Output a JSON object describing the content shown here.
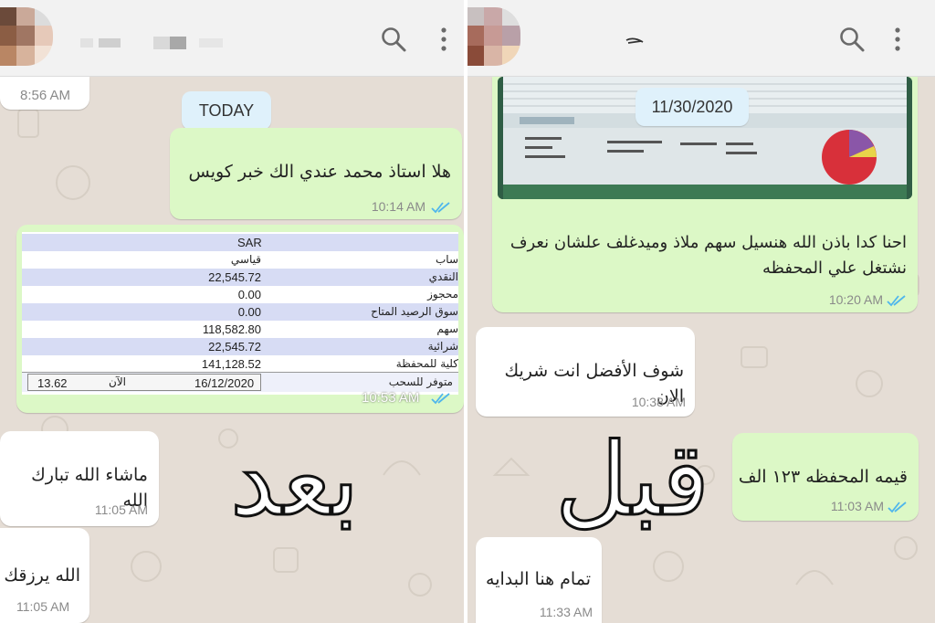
{
  "left_panel": {
    "header": {
      "search_icon": "search-icon",
      "menu_icon": "more-vert-icon"
    },
    "top_time": "8:56 AM",
    "date_chip": "TODAY",
    "messages": [
      {
        "text": "هلا استاذ محمد عندي الك خبر كويس",
        "time": "10:14 AM",
        "direction": "outgoing",
        "status": "read"
      },
      {
        "time": "10:53 AM",
        "direction": "outgoing",
        "status": "read",
        "type": "image"
      },
      {
        "text": "ماشاء الله تبارك الله",
        "time": "11:05 AM",
        "direction": "incoming"
      },
      {
        "text": "الله يرزقك",
        "time": "11:05 AM",
        "direction": "incoming"
      }
    ],
    "statement": {
      "currency": "SAR",
      "rows": [
        {
          "label": "ساب",
          "value": "قياسي"
        },
        {
          "label": "النقدي",
          "value": "22,545.72"
        },
        {
          "label": "محجوز",
          "value": "0.00"
        },
        {
          "label": "سوق الرصيد المتاح",
          "value": "0.00"
        },
        {
          "label": "سهم",
          "value": "118,582.80"
        },
        {
          "label": "شرائية",
          "value": "22,545.72"
        },
        {
          "label": "كلية للمحفظة",
          "value": "141,128.52"
        }
      ],
      "footer_label": "متوفر للسحب",
      "footer_date": "16/12/2020",
      "footer_now": "الآن",
      "footer_value": "13.62"
    },
    "overlay_word": "بعد"
  },
  "right_panel": {
    "header": {
      "search_icon": "search-icon",
      "menu_icon": "more-vert-icon"
    },
    "date_chip": "11/30/2020",
    "messages": [
      {
        "text": "احنا كدا باذن الله هنسيل سهم ملاذ وميدغلف علشان نعرف نشتغل علي المحفظه",
        "time": "10:20 AM",
        "direction": "outgoing",
        "status": "read"
      },
      {
        "text": "شوف الأفضل انت شريك الان",
        "time": "10:38 AM",
        "direction": "incoming"
      },
      {
        "text": "قيمه المحفظه ١٢٣ الف",
        "time": "11:03 AM",
        "direction": "outgoing",
        "status": "read"
      },
      {
        "text": "تمام هنا البدايه",
        "time": "11:33 AM",
        "direction": "incoming"
      }
    ],
    "overlay_word": "قبل"
  },
  "colors": {
    "outgoing_bubble": "#dcf8c6",
    "incoming_bubble": "#ffffff",
    "chat_background": "#e5ddd5",
    "read_ticks": "#4fb6ec",
    "date_chip": "#dff1fb"
  }
}
